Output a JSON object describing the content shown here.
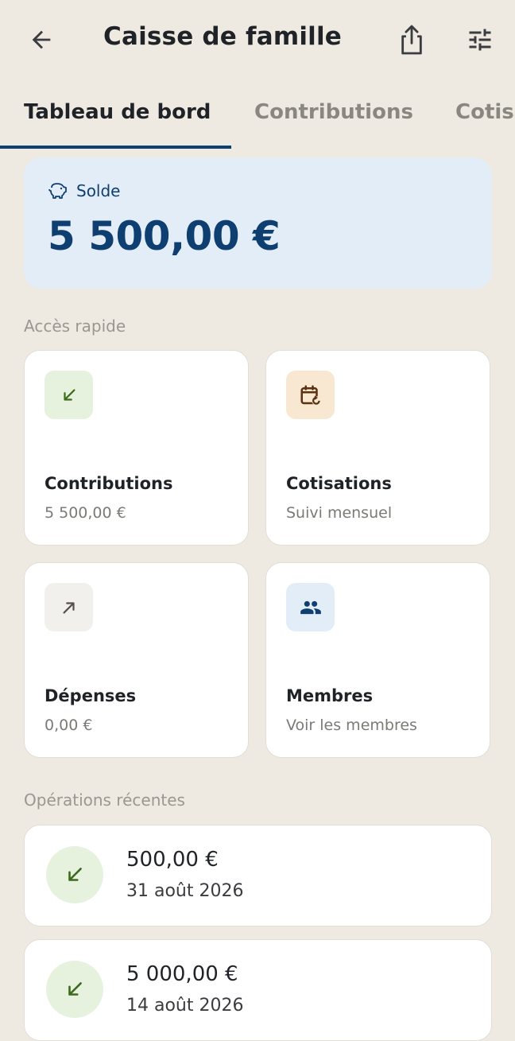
{
  "header": {
    "title": "Caisse de famille",
    "back_icon": "arrow-back-icon",
    "share_icon": "share-icon",
    "filter_icon": "tune-icon"
  },
  "tabs": [
    {
      "label": "Tableau de bord",
      "active": true
    },
    {
      "label": "Contributions",
      "active": false
    },
    {
      "label": "Cotisations",
      "active": false
    }
  ],
  "balance": {
    "label": "Solde",
    "amount": "5 500,00 €",
    "icon": "piggy-bank-icon"
  },
  "quick_access": {
    "label": "Accès rapide",
    "cards": [
      {
        "title": "Contributions",
        "subtitle": "5 500,00 €",
        "icon": "arrow-down-left-icon",
        "icon_bg": "#E6F1DE",
        "icon_color": "#3d6b1e"
      },
      {
        "title": "Cotisations",
        "subtitle": "Suivi mensuel",
        "icon": "calendar-refresh-icon",
        "icon_bg": "#F8E7D1",
        "icon_color": "#5a3210"
      },
      {
        "title": "Dépenses",
        "subtitle": "0,00 €",
        "icon": "arrow-up-right-icon",
        "icon_bg": "#F1F0EC",
        "icon_color": "#55524d"
      },
      {
        "title": "Membres",
        "subtitle": "Voir les membres",
        "icon": "people-icon",
        "icon_bg": "#E3EDF7",
        "icon_color": "#0f3f70"
      }
    ]
  },
  "recent": {
    "label": "Opérations récentes",
    "items": [
      {
        "amount": "500,00 €",
        "date": "31 août 2026",
        "icon": "arrow-down-left-icon"
      },
      {
        "amount": "5 000,00 €",
        "date": "14 août 2026",
        "icon": "arrow-down-left-icon"
      }
    ]
  },
  "colors": {
    "background": "#EEEAE1",
    "primary": "#0f3f70",
    "balance_card": "#E3EDF7",
    "income": "#3d6b1e"
  }
}
